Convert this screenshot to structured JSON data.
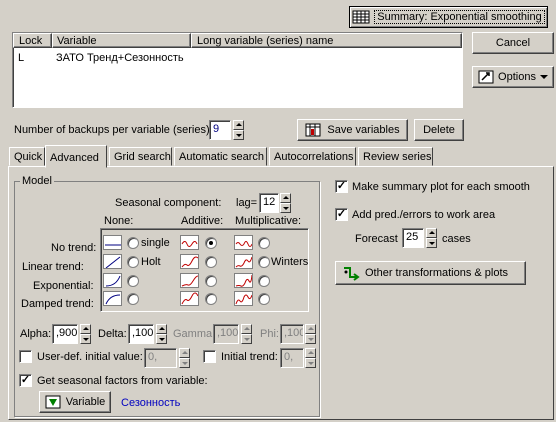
{
  "summary_button": "Summary:  Exponential smoothing",
  "cancel_button": "Cancel",
  "options_button": "Options",
  "variables_table": {
    "headers": [
      "Lock",
      "Variable",
      "Long variable (series) name"
    ],
    "rows": [
      {
        "lock": "L",
        "variable": "ЗАТО Тренд+Сезонность",
        "long_name": ""
      }
    ]
  },
  "backups": {
    "label": "Number of backups per variable (series):",
    "value": "9"
  },
  "save_variables_button": "Save variables",
  "delete_button": "Delete",
  "tabs": [
    "Quick",
    "Advanced",
    "Grid search",
    "Automatic search",
    "Autocorrelations",
    "Review series"
  ],
  "model": {
    "group_label": "Model",
    "seasonal_component_label": "Seasonal component:",
    "lag_label": "lag=",
    "lag_value": "12",
    "column_headers": [
      "None:",
      "Additive:",
      "Multiplicative:"
    ],
    "row_labels": [
      "No trend:",
      "Linear trend:",
      "Exponential:",
      "Damped trend:"
    ],
    "named_options": {
      "single": "single",
      "holt": "Holt",
      "winters": "Winters"
    },
    "selected": "No trend / Additive"
  },
  "params": {
    "alpha_label": "Alpha:",
    "alpha_value": ",900",
    "delta_label": "Delta:",
    "delta_value": ",100",
    "gamma_label": "Gamma:",
    "gamma_value": ",100",
    "phi_label": "Phi:",
    "phi_value": ",100"
  },
  "user_def_initial": {
    "label": "User-def. initial value:",
    "value": "0,",
    "checked": false
  },
  "initial_trend": {
    "label": "Initial trend:",
    "value": "0,",
    "checked": false
  },
  "seasonal_factors": {
    "label": "Get seasonal factors from variable:",
    "checked": true
  },
  "variable_button": "Variable",
  "seasonal_variable_name": "Сезонность",
  "summary_plot": {
    "label": "Make summary plot for each smooth",
    "checked": true
  },
  "add_pred_errors": {
    "label": "Add pred./errors to work area",
    "checked": true
  },
  "forecast": {
    "label": "Forecast",
    "value": "25",
    "unit": "cases"
  },
  "other_transformations_button": "Other transformations & plots"
}
